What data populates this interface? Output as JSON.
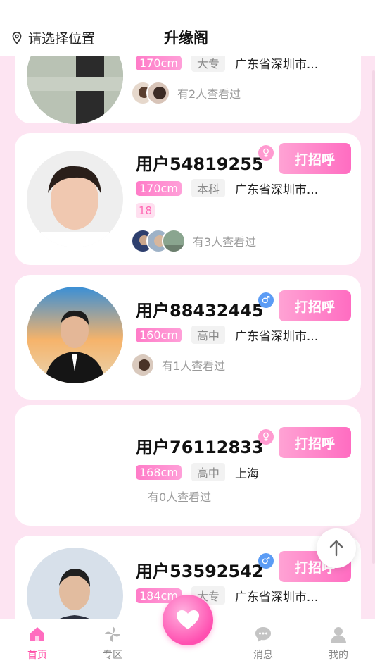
{
  "header": {
    "location_label": "请选择位置",
    "title": "升缘阁"
  },
  "cards": [
    {
      "name": "",
      "gender": "",
      "greet_label": "",
      "height": "170cm",
      "education": "大专",
      "location": "广东省深圳市...",
      "age": "",
      "viewers": "有2人查看过"
    },
    {
      "name": "用户54819255",
      "gender": "female",
      "greet_label": "打招呼",
      "height": "170cm",
      "education": "本科",
      "location": "广东省深圳市...",
      "age": "18",
      "viewers": "有3人查看过"
    },
    {
      "name": "用户88432445",
      "gender": "male",
      "greet_label": "打招呼",
      "height": "160cm",
      "education": "高中",
      "location": "广东省深圳市...",
      "age": "",
      "viewers": "有1人查看过"
    },
    {
      "name": "用户76112833",
      "gender": "female",
      "greet_label": "打招呼",
      "height": "168cm",
      "education": "高中",
      "location": "上海",
      "age": "",
      "viewers": "有0人查看过"
    },
    {
      "name": "用户53592542",
      "gender": "male",
      "greet_label": "打招呼",
      "height": "184cm",
      "education": "大专",
      "location": "广东省深圳市...",
      "age": "",
      "viewers": ""
    }
  ],
  "tabbar": {
    "tabs": [
      {
        "label": "首页",
        "icon": "home-icon",
        "active": true
      },
      {
        "label": "专区",
        "icon": "pinwheel-icon",
        "active": false
      },
      {
        "label": "消息",
        "icon": "chat-bubble-icon",
        "active": false
      },
      {
        "label": "我的",
        "icon": "person-icon",
        "active": false
      }
    ],
    "center_icon": "heart-icon"
  },
  "colors": {
    "accent_pink": "#ff4fa7",
    "background": "#fde4f2",
    "male": "#5b9cf5",
    "female": "#ff9ad0"
  }
}
